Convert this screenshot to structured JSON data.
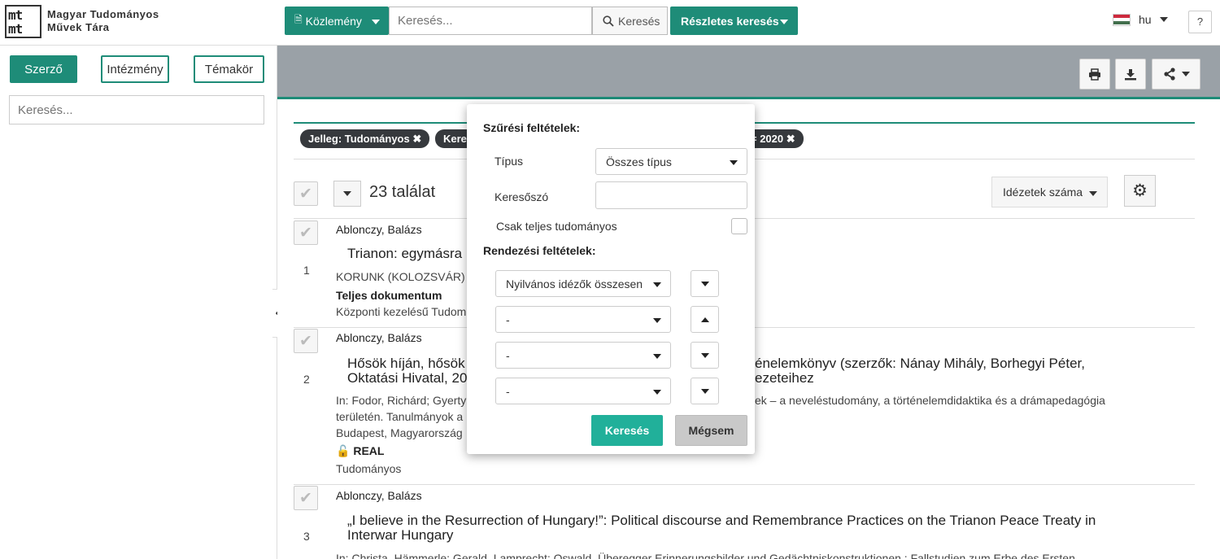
{
  "header": {
    "logo_text": "mt\nmt",
    "logo_line1": "Magyar Tudományos",
    "logo_line2": "Művek Tára",
    "publication_label": "Közlemény",
    "search_placeholder": "Keresés...",
    "search_button": "Keresés",
    "advanced_search": "Részletes keresés",
    "language": "hu",
    "help": "?"
  },
  "sidebar": {
    "tabs": [
      "Szerző",
      "Intézmény",
      "Témakör"
    ],
    "search_placeholder": "Keresés...",
    "collapse_icon": "‹"
  },
  "filters": {
    "chips": [
      "Jelleg: Tudományos ✖",
      "Kere",
      "= 2020 ✖"
    ]
  },
  "results": {
    "count_label": "23 találat",
    "sort_label": "Idézetek száma",
    "items": [
      {
        "num": "1",
        "author": "Ablonczy, Balázs",
        "title": "Trianon: egymásra",
        "journal": "KORUNK (KOLOZSVÁR) 30",
        "doc_type": "Teljes dokumentum",
        "owner": "Központi kezelésű Tudom"
      },
      {
        "num": "2",
        "author": "Ablonczy, Balázs",
        "title_left": "Hősök híján, hősök",
        "title_right": "énelemkönyv (szerzők: Nánay Mihály, Borhegyi Péter,",
        "title_line2_left": "Oktatási Hivatal, 20",
        "title_line2_right": "ezeteihez",
        "in_line_left": "In: Fodor, Richárd; Gyerty",
        "in_line_right": "ek – a neveléstudomány, a történelemdidaktika és a drámapedagógia",
        "in_line2": "területén. Tanulmányok a",
        "place": "Budapest, Magyarország",
        "repo": "REAL",
        "category": "Tudományos"
      },
      {
        "num": "3",
        "author": "Ablonczy, Balázs",
        "title": "„I believe in the Resurrection of Hungary!”: Political discourse and Remembrance Practices on the Trianon Peace Treaty in",
        "title_line2": "Interwar Hungary",
        "in_line": "In: Christa, Hämmerle; Gerald, Lamprecht; Oswald, Überegger Erinnerungsbilder und Gedächtniskonstruktionen : Fallstudien zum Erbe des Ersten"
      }
    ]
  },
  "modal": {
    "filter_heading": "Szűrési feltételek:",
    "type_label": "Típus",
    "type_value": "Összes típus",
    "keyword_label": "Keresőszó",
    "keyword_value": "",
    "only_full_label": "Csak teljes tudományos",
    "sort_heading": "Rendezési feltételek:",
    "sort_fields": [
      "Nyilvános idézők összesen",
      "-",
      "-",
      "-"
    ],
    "search_button": "Keresés",
    "cancel_button": "Mégsem"
  },
  "colors": {
    "accent": "#1e8c78",
    "modal_primary": "#21b09a",
    "band": "#9aa1a7"
  }
}
